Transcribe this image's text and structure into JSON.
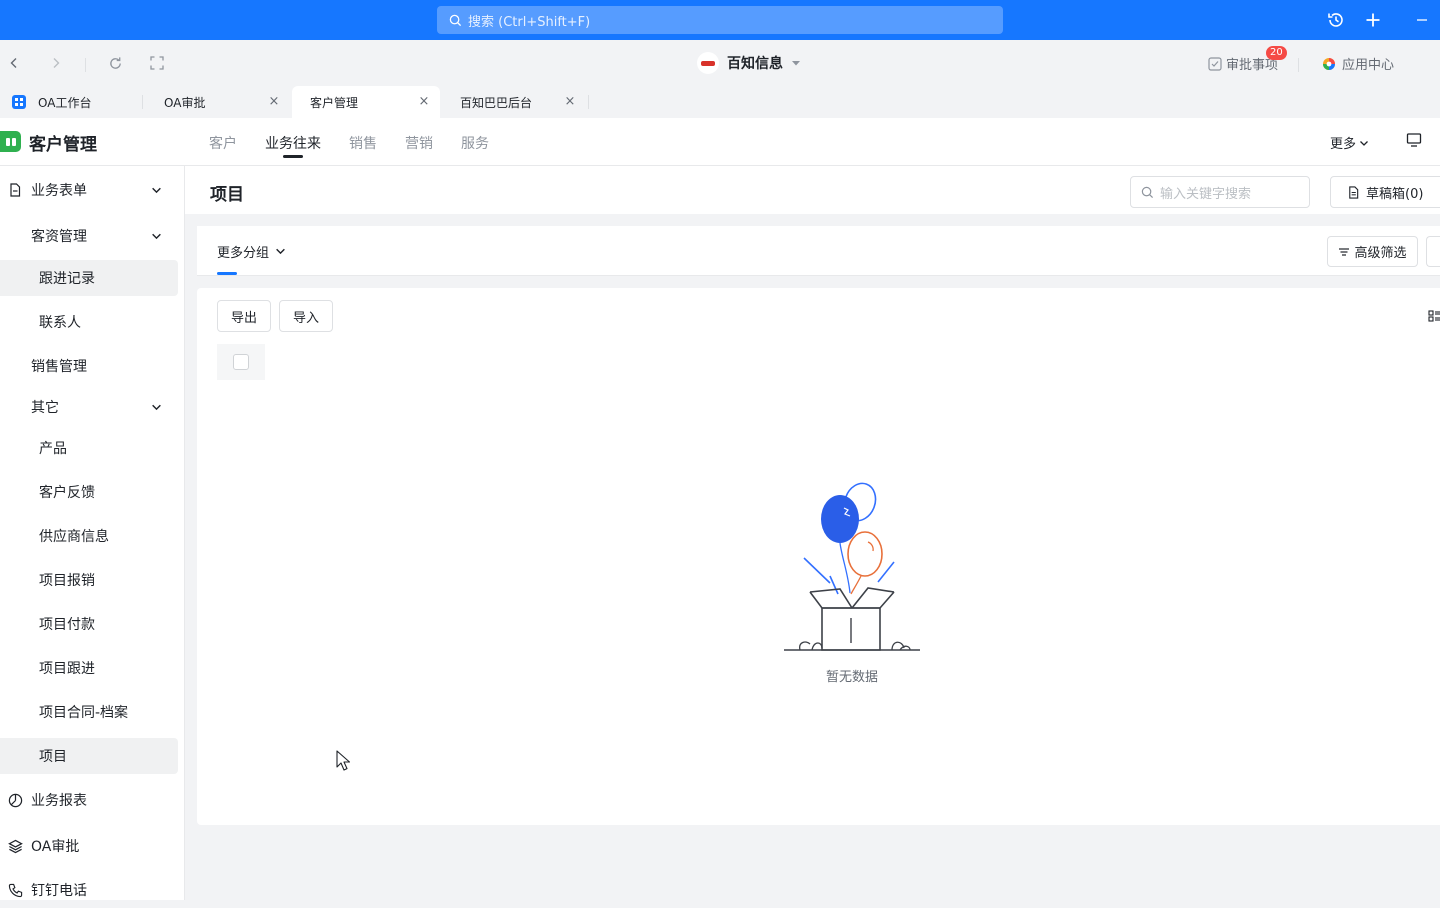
{
  "topbar": {
    "search_placeholder": "搜索 (Ctrl+Shift+F)"
  },
  "navbar": {
    "org_name": "百知信息",
    "approve_label": "审批事项",
    "approve_count": "20",
    "app_center_label": "应用中心"
  },
  "tabs": [
    {
      "label": "OA工作台",
      "closable": false
    },
    {
      "label": "OA审批",
      "closable": true
    },
    {
      "label": "客户管理",
      "closable": true,
      "active": true
    },
    {
      "label": "百知巴巴后台",
      "closable": true
    }
  ],
  "app": {
    "title": "客户管理",
    "nav": [
      "客户",
      "业务往来",
      "销售",
      "营销",
      "服务"
    ],
    "active_nav": "业务往来",
    "more_label": "更多"
  },
  "sidebar": {
    "items": [
      {
        "label": "业务表单",
        "level": 0,
        "icon": "document-icon",
        "expandable": true
      },
      {
        "label": "客资管理",
        "level": 1,
        "expandable": true
      },
      {
        "label": "跟进记录",
        "level": 2,
        "selected": true
      },
      {
        "label": "联系人",
        "level": 2
      },
      {
        "label": "销售管理",
        "level": 1
      },
      {
        "label": "其它",
        "level": 1,
        "expandable": true
      },
      {
        "label": "产品",
        "level": 2
      },
      {
        "label": "客户反馈",
        "level": 2
      },
      {
        "label": "供应商信息",
        "level": 2
      },
      {
        "label": "项目报销",
        "level": 2
      },
      {
        "label": "项目付款",
        "level": 2
      },
      {
        "label": "项目跟进",
        "level": 2
      },
      {
        "label": "项目合同-档案",
        "level": 2
      },
      {
        "label": "项目",
        "level": 2,
        "selected": true
      },
      {
        "label": "业务报表",
        "level": 0,
        "icon": "pie-chart-icon"
      },
      {
        "label": "OA审批",
        "level": 0,
        "icon": "layers-icon"
      },
      {
        "label": "钉钉电话",
        "level": 0,
        "icon": "phone-icon"
      }
    ]
  },
  "main": {
    "page_title": "项目",
    "search_placeholder": "输入关键字搜索",
    "drafts_label": "草稿箱(0)",
    "more_groups_label": "更多分组",
    "advanced_filter_label": "高级筛选",
    "export_label": "导出",
    "import_label": "导入",
    "empty_text": "暂无数据"
  },
  "colors": {
    "accent": "#1677ff",
    "app_logo": "#2fb04f",
    "badge": "#f54a45"
  }
}
